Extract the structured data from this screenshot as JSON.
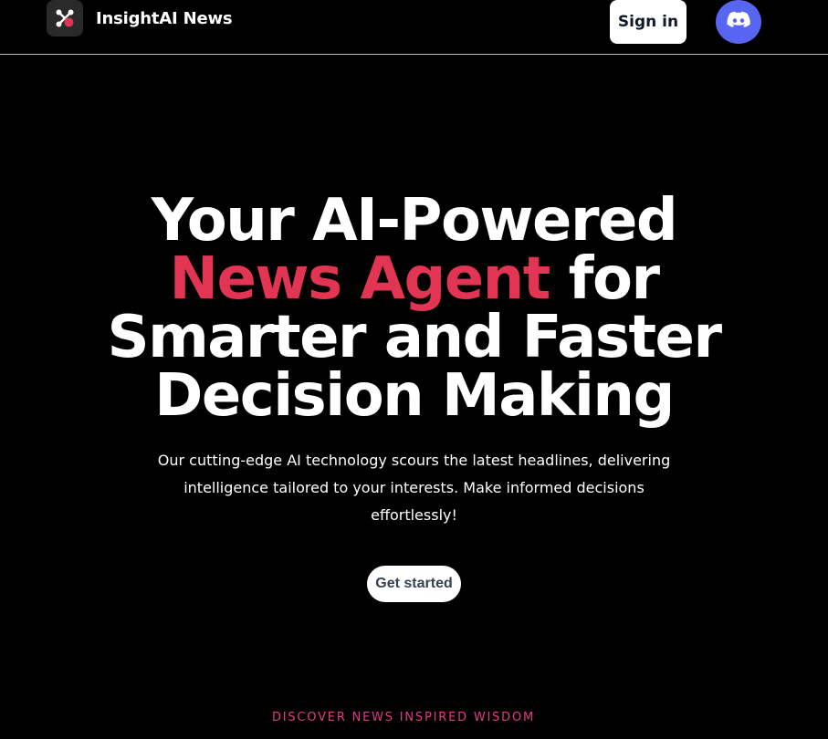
{
  "header": {
    "brand_name": "InsightAI News",
    "sign_in_label": "Sign in"
  },
  "hero": {
    "headline_part1": "Your AI-Powered",
    "headline_accent": "News Agent",
    "headline_part2": "for Smarter and Faster Decision Making",
    "subtitle": "Our cutting-edge AI technology scours the latest headlines, delivering intelligence tailored to your interests. Make informed decisions effortlessly!",
    "cta_label": "Get started"
  },
  "footer": {
    "tagline": "DISCOVER NEWS INSPIRED WISDOM"
  },
  "icons": {
    "logo": "network-logo-icon",
    "discord": "discord-icon"
  },
  "colors": {
    "background": "#000000",
    "accent": "#e23553",
    "tagline": "#e23b86",
    "discord": "#5865f2"
  }
}
